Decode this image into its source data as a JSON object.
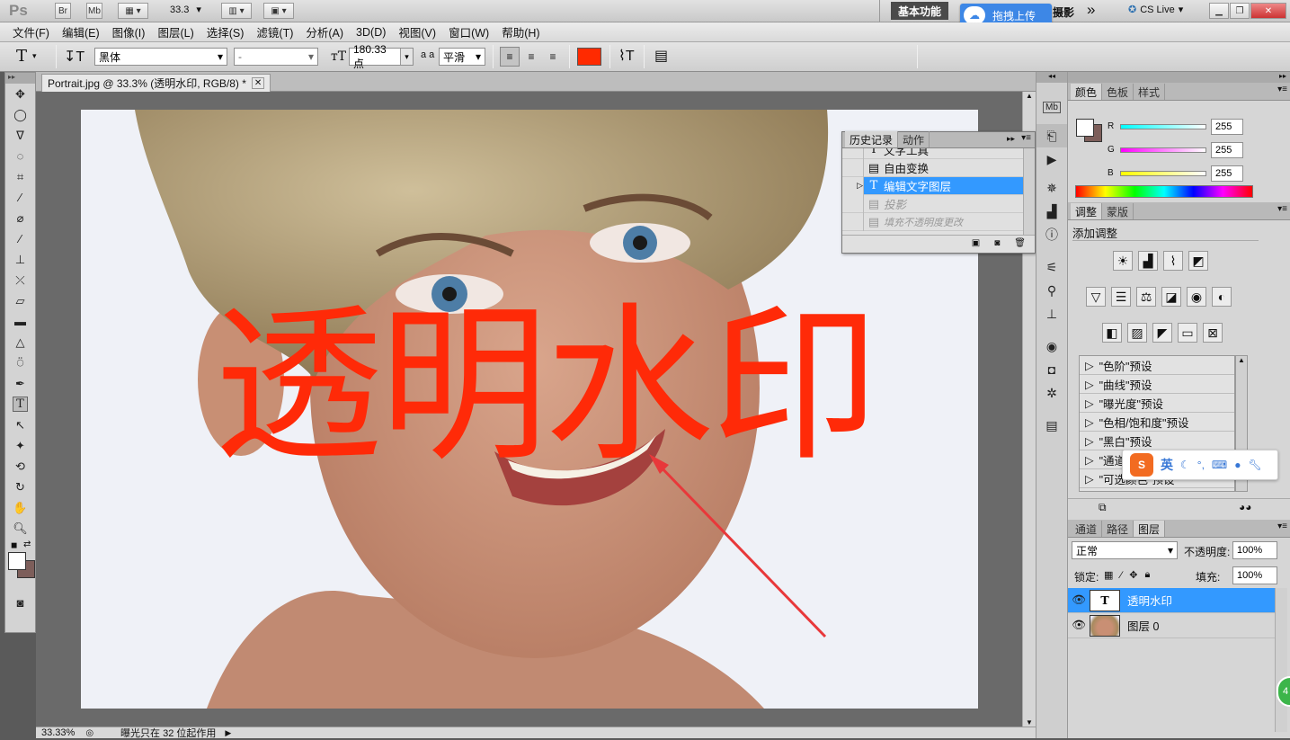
{
  "app": {
    "logo": "Ps",
    "br": "Br",
    "mb": "Mb",
    "zoom": "33.3",
    "workspace": "基本功能",
    "upload": "拖拽上传",
    "suffix": "摄影",
    "more": "»",
    "cslive": "CS Live"
  },
  "menu": [
    "文件(F)",
    "编辑(E)",
    "图像(I)",
    "图层(L)",
    "选择(S)",
    "滤镜(T)",
    "分析(A)",
    "3D(D)",
    "视图(V)",
    "窗口(W)",
    "帮助(H)"
  ],
  "options": {
    "tool_glyph": "T",
    "font_family": "黑体",
    "font_style": "-",
    "font_size": "180.33 点",
    "aa_label": "a a",
    "aa_mode": "平滑",
    "color": "#ff2a00"
  },
  "document": {
    "tab_title": "Portrait.jpg @ 33.3% (透明水印, RGB/8) *",
    "watermark": "透明水印"
  },
  "status": {
    "zoom": "33.33%",
    "message": "曝光只在 32 位起作用"
  },
  "history": {
    "tabs": [
      "历史记录",
      "动作"
    ],
    "items": [
      {
        "label": "文字工具",
        "icon": "T",
        "state": "normal"
      },
      {
        "label": "自由变换",
        "icon": "▤",
        "state": "normal"
      },
      {
        "label": "编辑文字图层",
        "icon": "T",
        "state": "selected"
      },
      {
        "label": "投影",
        "icon": "▤",
        "state": "disabled"
      },
      {
        "label": "填充不透明度更改",
        "icon": "▤",
        "state": "disabled"
      }
    ]
  },
  "color_panel": {
    "tabs": [
      "颜色",
      "色板",
      "样式"
    ],
    "channels": [
      {
        "name": "R",
        "value": "255"
      },
      {
        "name": "G",
        "value": "255"
      },
      {
        "name": "B",
        "value": "255"
      }
    ]
  },
  "adjust_panel": {
    "tabs": [
      "调整",
      "蒙版"
    ],
    "title": "添加调整",
    "presets": [
      "\"色阶\"预设",
      "\"曲线\"预设",
      "\"曝光度\"预设",
      "\"色相/饱和度\"预设",
      "\"黑白\"预设",
      "\"通道混合器\"预设",
      "\"可选颜色\"预设"
    ]
  },
  "ime": {
    "lang": "英"
  },
  "layers_panel": {
    "tabs": [
      "通道",
      "路径",
      "图层"
    ],
    "blend_mode": "正常",
    "opacity_label": "不透明度:",
    "opacity": "100%",
    "lock_label": "锁定:",
    "fill_label": "填充:",
    "fill": "100%",
    "layers": [
      {
        "name": "透明水印",
        "type": "text",
        "selected": true
      },
      {
        "name": "图层 0",
        "type": "image",
        "selected": false
      }
    ]
  },
  "colors": {
    "accent": "#3399ff",
    "watermark": "#ff2a08",
    "annotation_arrow": "#e8383a"
  }
}
